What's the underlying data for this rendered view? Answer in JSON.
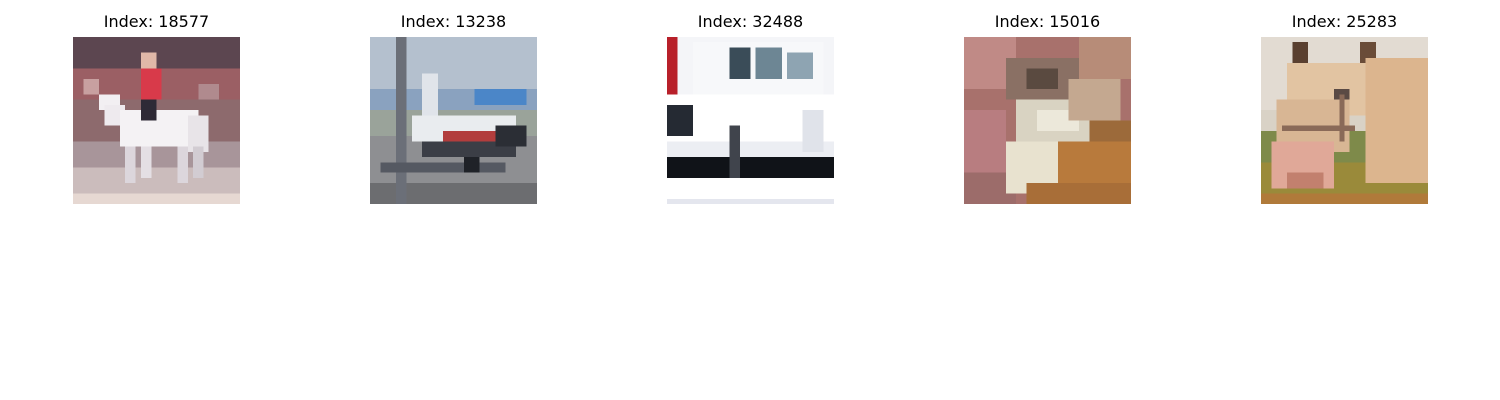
{
  "figure": {
    "panels": [
      {
        "title": "Index: 18577",
        "image_icon": "rider-on-white-horse-photo",
        "colors": {
          "background": "#9a6a6e",
          "subject": "#f2f0f2",
          "accent": "#d83a4a"
        }
      },
      {
        "title": "Index: 13238",
        "image_icon": "airplane-on-runway-photo",
        "colors": {
          "background": "#9aaabd",
          "subject": "#e9ecef",
          "accent": "#b23d3d"
        }
      },
      {
        "title": "Index: 32488",
        "image_icon": "white-truck-photo",
        "colors": {
          "background": "#f4f5f8",
          "subject": "#ffffff",
          "accent": "#101318"
        }
      },
      {
        "title": "Index: 15016",
        "image_icon": "cat-closeup-photo",
        "colors": {
          "background": "#b57a74",
          "subject": "#e8e2cf",
          "accent": "#b87a3c"
        }
      },
      {
        "title": "Index: 25283",
        "image_icon": "horse-head-photo",
        "colors": {
          "background": "#d9cdbf",
          "subject": "#dcb58e",
          "accent": "#8b7a3a"
        }
      }
    ]
  }
}
